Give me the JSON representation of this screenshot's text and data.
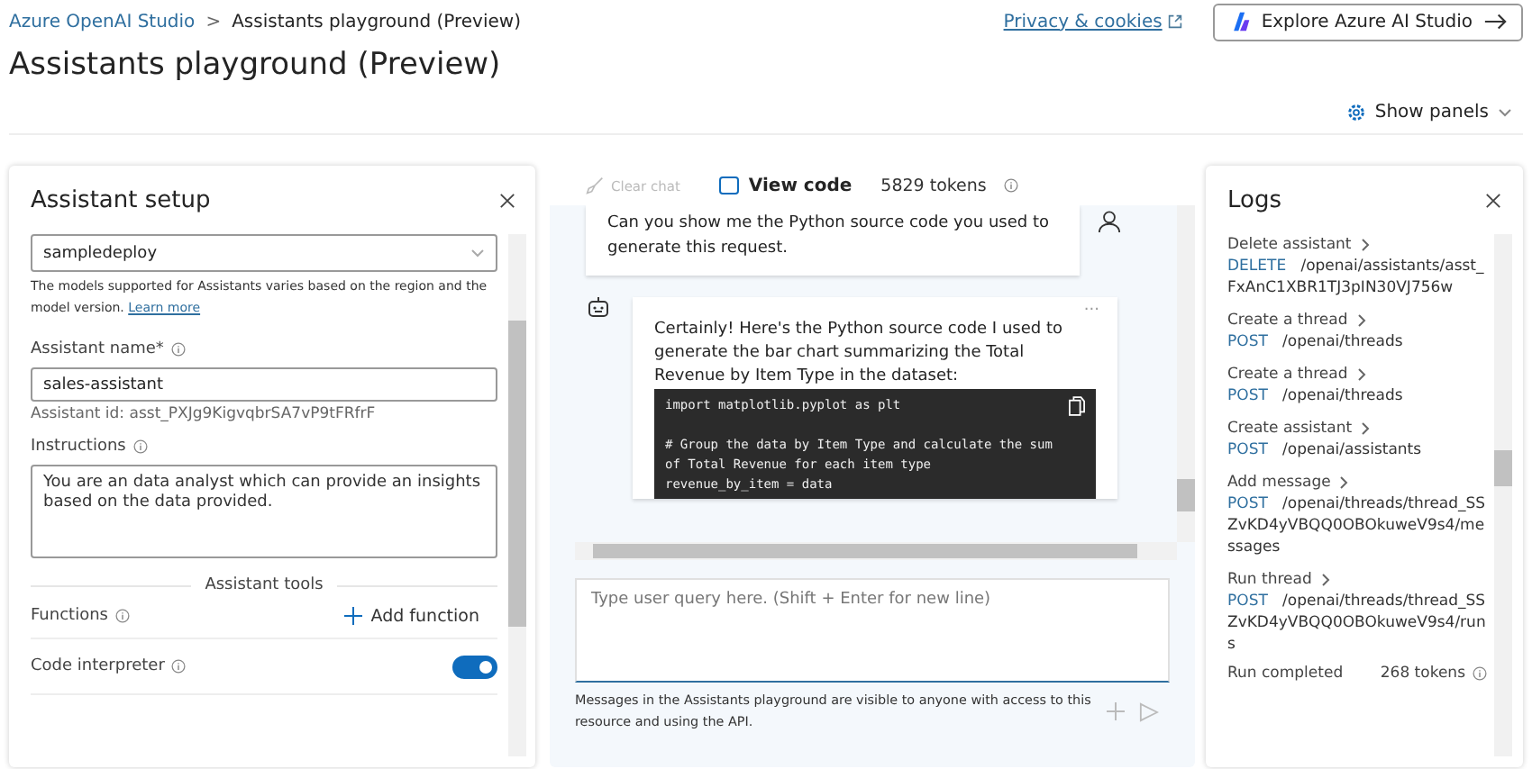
{
  "breadcrumb": {
    "parent": "Azure OpenAI Studio",
    "separator": ">",
    "current": "Assistants playground (Preview)"
  },
  "top_links": {
    "privacy": "Privacy & cookies",
    "explore": "Explore Azure AI Studio"
  },
  "page_title": "Assistants playground (Preview)",
  "show_panels": "Show panels",
  "setup": {
    "title": "Assistant setup",
    "deployment": "sampledeploy",
    "deployment_note": "The models supported for Assistants varies based on the region and the model version.",
    "learn_more": "Learn more",
    "name_label": "Assistant name*",
    "name_value": "sales-assistant",
    "assistant_id": "Assistant id: asst_PXJg9KigvqbrSA7vP9tFRfrF",
    "instructions_label": "Instructions",
    "instructions_value": "You are an data analyst which can provide an insights based on the data provided.",
    "tools_heading": "Assistant tools",
    "functions_label": "Functions",
    "add_function": "Add function",
    "code_interpreter_label": "Code interpreter",
    "code_interpreter_on": true
  },
  "chat": {
    "toolbar": {
      "clear_chat": "Clear chat",
      "clear_chat_disabled": true,
      "view_code": "View code",
      "tokens": "5829 tokens"
    },
    "messages": [
      {
        "kind": "user",
        "text": "Can you show me the Python source code you used to generate this request."
      },
      {
        "kind": "assistant",
        "more": "...",
        "text": "Certainly! Here's the Python source code I used to generate the bar chart summarizing the Total Revenue by Item Type in the dataset:",
        "code": [
          "import matplotlib.pyplot as plt",
          "# Group the data by Item Type and calculate the sum of Total Revenue for each item type",
          "revenue_by_item = data"
        ]
      }
    ],
    "input_placeholder": "Type user query here. (Shift + Enter for new line)",
    "notice": "Messages in the Assistants playground are visible to anyone with access to this resource and using the API."
  },
  "logs": {
    "title": "Logs",
    "entries": [
      {
        "label": "Delete assistant",
        "method": "DELETE",
        "path": "/openai/assistants/asst_FxAnC1XBR1TJ3pIN30VJ756w"
      },
      {
        "label": "Create a thread",
        "method": "POST",
        "path": "/openai/threads"
      },
      {
        "label": "Create a thread",
        "method": "POST",
        "path": "/openai/threads"
      },
      {
        "label": "Create assistant",
        "method": "POST",
        "path": "/openai/assistants"
      },
      {
        "label": "Add message",
        "method": "POST",
        "path": "/openai/threads/thread_SSZvKD4yVBQQ0OBOkuweV9s4/messages"
      },
      {
        "label": "Run thread",
        "method": "POST",
        "path": "/openai/threads/thread_SSZvKD4yVBQQ0OBOkuweV9s4/runs"
      }
    ],
    "footer_status": "Run completed",
    "footer_tokens": "268 tokens"
  }
}
